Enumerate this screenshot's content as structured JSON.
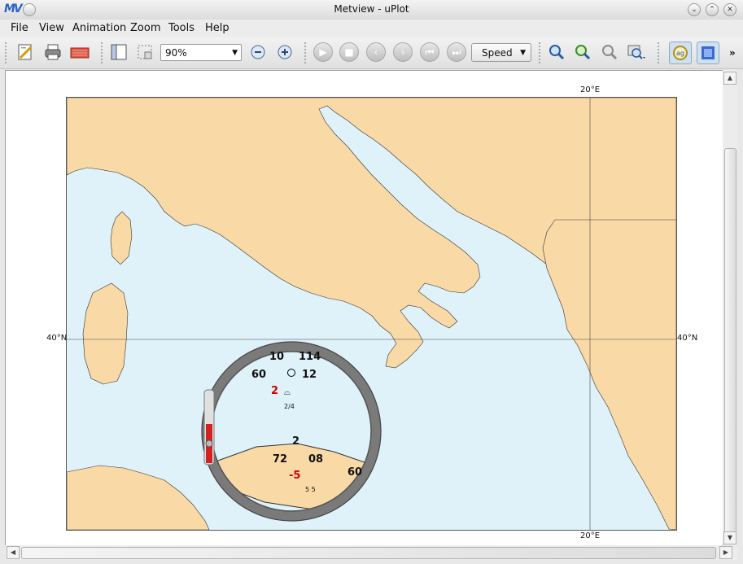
{
  "window": {
    "title": "Metview - uPlot"
  },
  "menu": [
    "File",
    "View",
    "Animation",
    "Zoom",
    "Tools",
    "Help"
  ],
  "toolbar": {
    "zoom_value": "90%",
    "speed_label": "Speed"
  },
  "map": {
    "lat_label_left": "40°N",
    "lat_label_right": "40°N",
    "lon_label_top": "20°E",
    "lon_label_bottom": "20°E"
  },
  "magnified_station": {
    "top_left": "10",
    "top_right": "114",
    "mid_left": "60",
    "mid_right": "12",
    "red_value": "2",
    "cloud_code": "2/4"
  },
  "sicily_station": {
    "top": "2",
    "mid_left": "72",
    "mid_right": "08",
    "red_value": "-5",
    "right_value": "60",
    "bottom": "5 5"
  },
  "colors": {
    "land": "#f9d9a6",
    "sea": "#dff2fa",
    "accent": "#d40000"
  }
}
